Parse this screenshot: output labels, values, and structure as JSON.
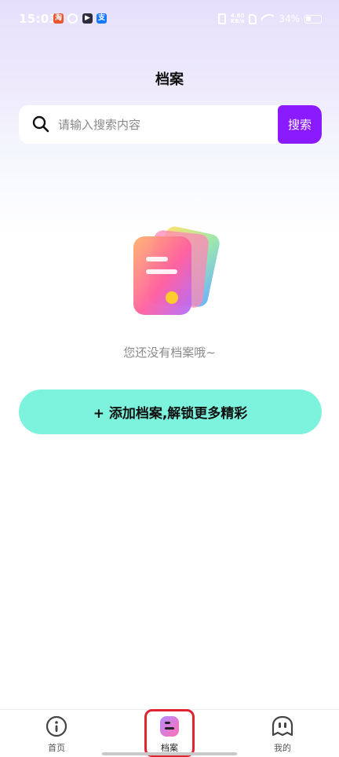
{
  "status_bar": {
    "time": "15:03",
    "notification_icons": [
      "淘",
      "",
      "",
      "支"
    ],
    "network_speed_value": "4.60",
    "network_speed_unit": "KB/s",
    "battery": "34%"
  },
  "header": {
    "title": "档案"
  },
  "search": {
    "placeholder": "请输入搜索内容",
    "value": "",
    "button_label": "搜索"
  },
  "empty_state": {
    "message": "您还没有档案哦~"
  },
  "add_button": {
    "label": "+ 添加档案,解锁更多精彩"
  },
  "tabs": [
    {
      "label": "首页",
      "icon": "home-icon",
      "active": false
    },
    {
      "label": "档案",
      "icon": "archive-icon",
      "active": true
    },
    {
      "label": "我的",
      "icon": "profile-icon",
      "active": false
    }
  ],
  "colors": {
    "accent_purple": "#8b1bff",
    "add_button_bg": "#7df2dd",
    "highlight_red": "#e0242f"
  }
}
